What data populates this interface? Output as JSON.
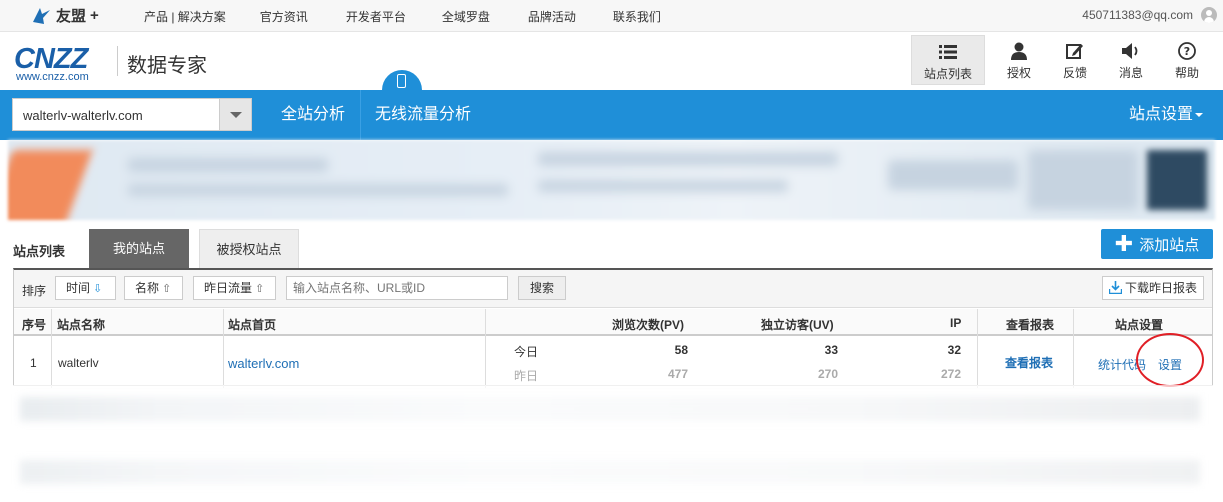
{
  "topbar": {
    "brand": "友盟",
    "brand_plus": "+",
    "nav": [
      "产品 | 解决方案",
      "官方资讯",
      "开发者平台",
      "全域罗盘",
      "品牌活动",
      "联系我们"
    ],
    "account": "450711383@qq.com"
  },
  "header": {
    "logo_text": "CNZZ",
    "logo_url": "www.cnzz.com",
    "title": "数据专家",
    "tools": [
      {
        "label": "站点列表",
        "icon": "list-icon"
      },
      {
        "label": "授权",
        "icon": "user-icon"
      },
      {
        "label": "反馈",
        "icon": "edit-icon"
      },
      {
        "label": "消息",
        "icon": "speaker-icon"
      },
      {
        "label": "帮助",
        "icon": "help-icon"
      }
    ]
  },
  "navbar": {
    "site_select_value": "walterlv-walterlv.com",
    "tabs": [
      "全站分析",
      "无线流量分析"
    ],
    "settings": "站点设置"
  },
  "site_list": {
    "label": "站点列表",
    "tabs": [
      "我的站点",
      "被授权站点"
    ],
    "add_button": "添加站点"
  },
  "filter": {
    "sort_label": "排序",
    "sort_time": "时间",
    "sort_name": "名称",
    "sort_yesterday": "昨日流量",
    "search_placeholder": "输入站点名称、URL或ID",
    "search_button": "搜索",
    "download_button": "下载昨日报表"
  },
  "table": {
    "columns": {
      "index": "序号",
      "name": "站点名称",
      "home": "站点首页",
      "pv": "浏览次数(PV)",
      "uv": "独立访客(UV)",
      "ip": "IP",
      "report": "查看报表",
      "settings": "站点设置"
    },
    "rows": [
      {
        "index": "1",
        "name": "walterlv",
        "home": "walterlv.com",
        "today_label": "今日",
        "yesterday_label": "昨日",
        "pv_today": "58",
        "pv_yesterday": "477",
        "uv_today": "33",
        "uv_yesterday": "270",
        "ip_today": "32",
        "ip_yesterday": "272",
        "report_link": "查看报表",
        "code_link": "统计代码",
        "settings_link": "设置"
      }
    ]
  },
  "colors": {
    "primary_blue": "#1f8fd8",
    "logo_blue": "#1a5fa8",
    "highlight_red": "#e01f26"
  }
}
